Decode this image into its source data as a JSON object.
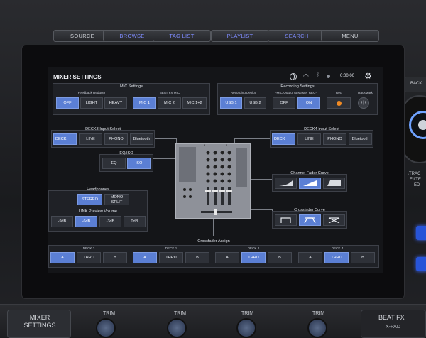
{
  "hardware": {
    "top_buttons": [
      "SOURCE",
      "BROWSE",
      "TAG LIST",
      "PLAYLIST",
      "SEARCH",
      "MENU"
    ],
    "right_back": "BACK",
    "right_track": "‹TRAC",
    "right_filter": "FILTE",
    "right_ed": "—ED",
    "bottom_left": "MIXER\nSETTINGS",
    "bottom_left_1": "MIXER",
    "bottom_left_2": "SETTINGS",
    "trim": "TRIM",
    "beat_fx": "BEAT FX",
    "x_pad": "X-PAD"
  },
  "screen": {
    "title": "MIXER SETTINGS",
    "time": "0:00:00",
    "mic": {
      "title": "MIC Settings",
      "feedback_label": "Feedback Reducer",
      "feedback_options": [
        "OFF",
        "LIGHT",
        "HEAVY"
      ],
      "feedback_selected": 0,
      "beatfx_label": "BEAT FX MIC",
      "beatfx_options": [
        "MIC 1",
        "MIC 2",
        "MIC 1+2"
      ],
      "beatfx_selected": 0
    },
    "recording": {
      "title": "Recording Settings",
      "device_label": "Recording Device",
      "device_options": [
        "USB 1",
        "USB 2"
      ],
      "device_selected": 0,
      "master_label": "-MIC Output to Master REC-",
      "master_options": [
        "OFF",
        "ON"
      ],
      "master_selected": 1,
      "rec_label": "Rec",
      "trackmark_label": "TrackMark"
    },
    "deck3_input": {
      "title": "DECK3 Input Select",
      "options": [
        "DECK",
        "LINE",
        "PHONO",
        "Bluetooth"
      ],
      "selected": 0
    },
    "deck4_input": {
      "title": "DECK4 Input Select",
      "options": [
        "DECK",
        "LINE",
        "PHONO",
        "Bluetooth"
      ],
      "selected": 0
    },
    "eqiso": {
      "title": "EQ/ISO",
      "options": [
        "EQ",
        "ISO"
      ],
      "selected": 1
    },
    "headphones": {
      "title": "Headphones",
      "options": [
        "STEREO",
        "MONO SPLIT"
      ],
      "selected": 0,
      "mono_1": "MONO",
      "mono_2": "SPLIT",
      "link_label": "LINK Preview Volume",
      "link_options": [
        "-9dB",
        "-6dB",
        "-3dB",
        "0dB"
      ],
      "link_selected": 1
    },
    "channel_fader": {
      "title": "Channel Fader Curve",
      "selected": 1
    },
    "crossfader": {
      "title": "Crossfader Curve",
      "selected": 1
    },
    "crossfader_assign": {
      "title": "Crossfader Assign",
      "decks": [
        {
          "name": "DECK 3",
          "selected": 0
        },
        {
          "name": "DECK 1",
          "selected": 0
        },
        {
          "name": "DECK 2",
          "selected": 1
        },
        {
          "name": "DECK 4",
          "selected": 1
        }
      ],
      "options": [
        "A",
        "THRU",
        "B"
      ]
    },
    "mixer_numbers": [
      "3",
      "4"
    ]
  },
  "colors": {
    "accent": "#5b7fd4",
    "rec": "#f08a24",
    "hw_blue_text": "#7f8cff"
  }
}
